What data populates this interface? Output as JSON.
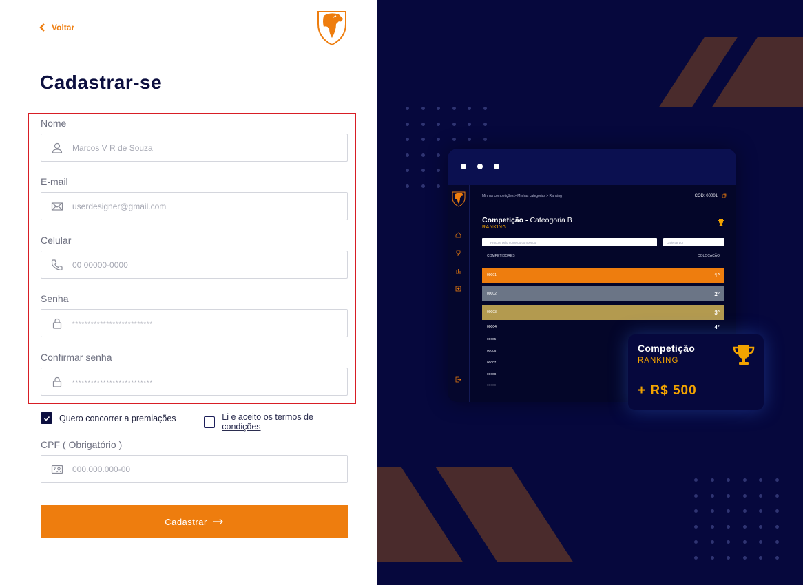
{
  "nav": {
    "back_label": "Voltar"
  },
  "page": {
    "title": "Cadastrar-se"
  },
  "form": {
    "fields": [
      {
        "label": "Nome",
        "placeholder": "Marcos V R de Souza",
        "icon": "user-icon"
      },
      {
        "label": "E-mail",
        "placeholder": "userdesigner@gmail.com",
        "icon": "mail-icon"
      },
      {
        "label": "Celular",
        "placeholder": "00 00000-0000",
        "icon": "phone-icon"
      },
      {
        "label": "Senha",
        "placeholder": "**************************",
        "icon": "lock-icon"
      },
      {
        "label": "Confirmar senha",
        "placeholder": "**************************",
        "icon": "lock-icon"
      }
    ],
    "checkboxes": [
      {
        "label": "Quero concorrer a premiações",
        "checked": true
      },
      {
        "label": "Li e aceito os termos de condições",
        "checked": false
      }
    ],
    "cpf": {
      "label": "CPF ( Obrigatório )",
      "placeholder": "000.000.000-00",
      "icon": "id-card-icon"
    },
    "submit_label": "Cadastrar"
  },
  "colors": {
    "accent": "#ee7d0e",
    "navy": "#0c0f3f",
    "panel": "#06083d",
    "highlight": "#d81e25",
    "gold": "#f2a300"
  },
  "preview": {
    "breadcrumb": "Minhas competições  >  Minhas categorias  >  Ranking",
    "cod": "COD: 00001",
    "title_bold": "Competição -",
    "title_rest": "Cateogoria B",
    "subtitle": "RANKING",
    "search_placeholder": "Procure pelo nome do competidor",
    "order_placeholder": "Ordenar por",
    "col_competitors": "COMPETIDORES",
    "col_position": "COLOCAÇÃO",
    "podium": [
      {
        "code": "00001",
        "place": "1°",
        "color": "#ee7d0e"
      },
      {
        "code": "00002",
        "place": "2°",
        "color": "#6b7586"
      },
      {
        "code": "00003",
        "place": "3°",
        "color": "#b39a4f"
      }
    ],
    "fourth": {
      "code": "00004",
      "place": "4°"
    },
    "rest": [
      "00005",
      "00006",
      "00007",
      "00008",
      "00009"
    ]
  },
  "card": {
    "title": "Competição",
    "subtitle": "RANKING",
    "prize": "+ R$  500"
  }
}
